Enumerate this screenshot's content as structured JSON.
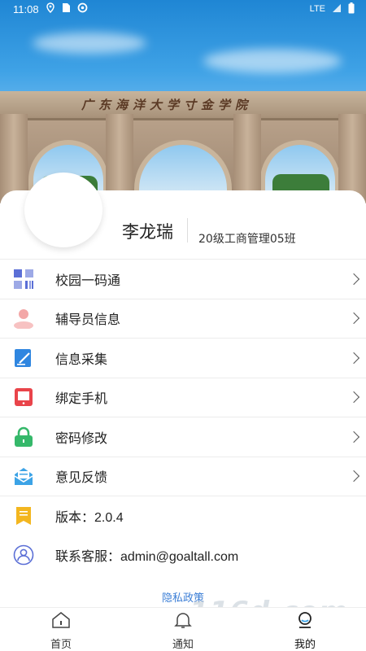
{
  "status_bar": {
    "time": "11:08",
    "network": "LTE",
    "left_icons": [
      "location-icon",
      "sim-icon",
      "data-saver-icon"
    ],
    "right_icons": [
      "signal-icon",
      "battery-icon"
    ]
  },
  "hero": {
    "image": "campus-gate-photo",
    "inscription": "广东海洋大学寸金学院"
  },
  "profile": {
    "name": "李龙瑞",
    "class": "20级工商管理05班"
  },
  "menu": {
    "items": [
      {
        "label": "校园一码通",
        "icon": "qr-code-icon",
        "color": "#5b6fd6"
      },
      {
        "label": "辅导员信息",
        "icon": "person-icon",
        "color": "#f3a7a7"
      },
      {
        "label": "信息采集",
        "icon": "edit-doc-icon",
        "color": "#2f86e0"
      },
      {
        "label": "绑定手机",
        "icon": "phone-icon",
        "color": "#e9444a"
      },
      {
        "label": "密码修改",
        "icon": "lock-icon",
        "color": "#35b86a"
      },
      {
        "label": "意见反馈",
        "icon": "feedback-icon",
        "color": "#3ca3e6"
      }
    ],
    "version": {
      "label": "版本：2.0.4",
      "icon": "bookmark-icon",
      "color": "#f3b61f"
    },
    "support": {
      "label": "联系客服：admin@goaltall.com",
      "icon": "user-circle-icon",
      "color": "#5b6fd6"
    }
  },
  "privacy_link": "隐私政策",
  "tabbar": {
    "tabs": [
      {
        "label": "首页",
        "icon": "home-icon"
      },
      {
        "label": "通知",
        "icon": "bell-icon"
      },
      {
        "label": "我的",
        "icon": "profile-icon",
        "active": true
      }
    ]
  },
  "watermark": "116d.com"
}
